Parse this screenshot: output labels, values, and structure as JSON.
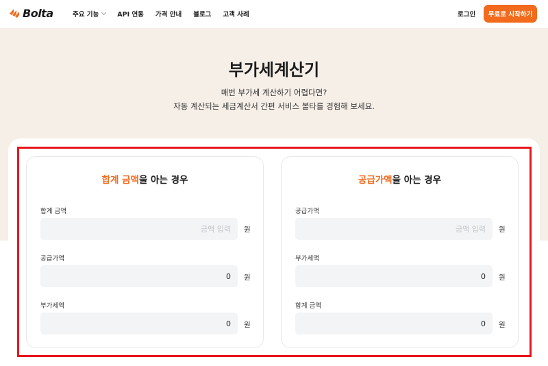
{
  "brand": {
    "name": "Bolta",
    "accent_color": "#f26a1b"
  },
  "nav": {
    "items": [
      {
        "label": "주요 기능",
        "has_dropdown": true
      },
      {
        "label": "API 연동"
      },
      {
        "label": "가격 안내"
      },
      {
        "label": "블로그"
      },
      {
        "label": "고객 사례"
      }
    ],
    "login": "로그인",
    "cta": "무료로 시작하기"
  },
  "hero": {
    "title": "부가세계산기",
    "line1": "매번 부가세 계산하기 어렵다면?",
    "line2": "자동 계산되는 세금계산서 간편 서비스 볼타를 경험해 보세요."
  },
  "left": {
    "title_accent": "합계 금액",
    "title_rest": "을 아는 경우",
    "fields": [
      {
        "label": "합계 금액",
        "value": "",
        "placeholder": "금액 입력",
        "unit": "원"
      },
      {
        "label": "공급가액",
        "value": "0",
        "placeholder": "",
        "unit": "원"
      },
      {
        "label": "부가세액",
        "value": "0",
        "placeholder": "",
        "unit": "원"
      }
    ]
  },
  "right": {
    "title_accent": "공급가액",
    "title_rest": "을 아는 경우",
    "fields": [
      {
        "label": "공급가액",
        "value": "",
        "placeholder": "금액 입력",
        "unit": "원"
      },
      {
        "label": "부가세액",
        "value": "0",
        "placeholder": "",
        "unit": "원"
      },
      {
        "label": "합계 금액",
        "value": "0",
        "placeholder": "",
        "unit": "원"
      }
    ]
  }
}
